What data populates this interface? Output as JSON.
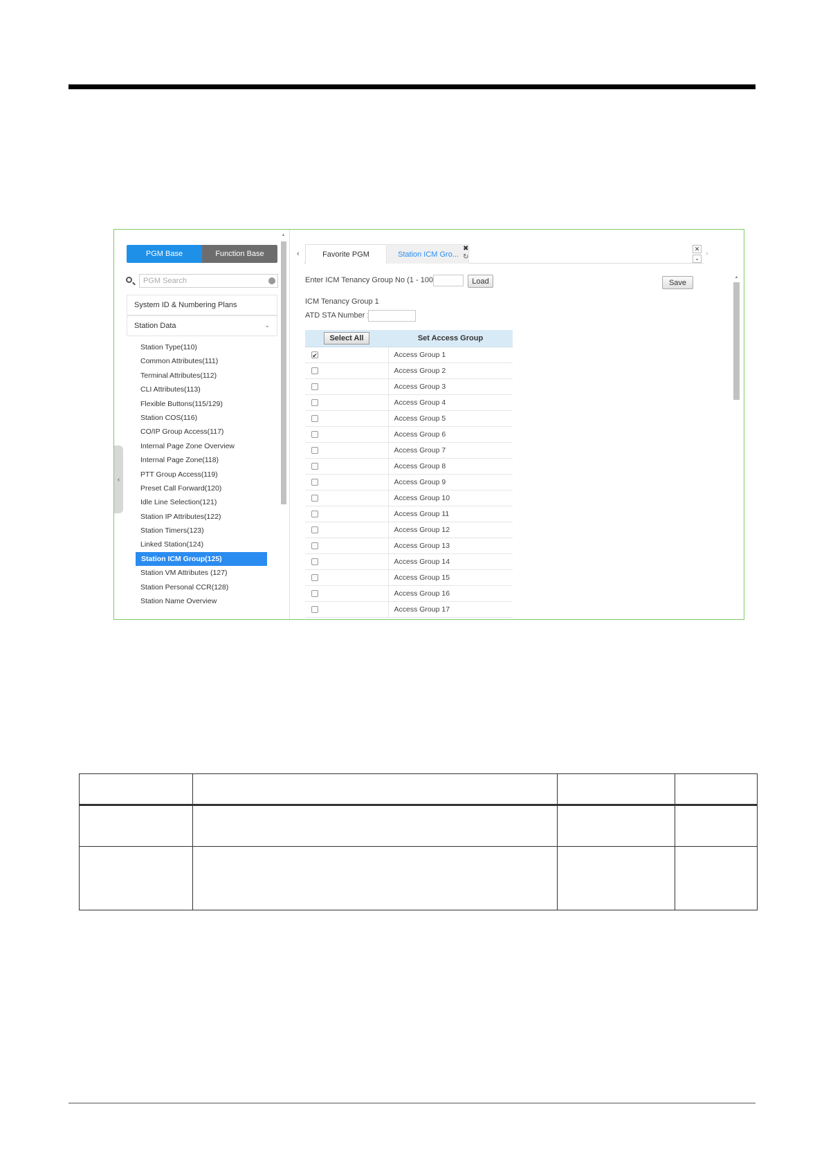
{
  "left_panel": {
    "segment": [
      "PGM Base",
      "Function Base"
    ],
    "search_placeholder": "PGM Search",
    "system_item": "System ID & Numbering Plans",
    "station_data": "Station Data",
    "menu_items": [
      "Station Type(110)",
      "Common Attributes(111)",
      "Terminal Attributes(112)",
      "CLI Attributes(113)",
      "Flexible Buttons(115/129)",
      "Station COS(116)",
      "CO/IP Group Access(117)",
      "Internal Page Zone Overview",
      "Internal Page Zone(118)",
      "PTT Group Access(119)",
      "Preset Call Forward(120)",
      "Idle Line Selection(121)",
      "Station IP Attributes(122)",
      "Station Timers(123)",
      "Linked Station(124)",
      "Station ICM Group(125)",
      "Station VM Attributes (127)",
      "Station Personal CCR(128)",
      "Station Name Overview"
    ],
    "active_index": 15
  },
  "tabs": {
    "favorite": "Favorite PGM",
    "current": "Station ICM Gro..."
  },
  "form": {
    "tenancy_label": "Enter ICM Tenancy Group No (1 - 100) :",
    "load": "Load",
    "save": "Save",
    "group_title": "ICM Tenancy Group 1",
    "atd_label": "ATD STA Number :"
  },
  "grid": {
    "select_all": "Select All",
    "header": "Set Access Group",
    "rows": [
      {
        "name": "Access Group 1",
        "checked": true
      },
      {
        "name": "Access Group 2",
        "checked": false
      },
      {
        "name": "Access Group 3",
        "checked": false
      },
      {
        "name": "Access Group 4",
        "checked": false
      },
      {
        "name": "Access Group 5",
        "checked": false
      },
      {
        "name": "Access Group 6",
        "checked": false
      },
      {
        "name": "Access Group 7",
        "checked": false
      },
      {
        "name": "Access Group 8",
        "checked": false
      },
      {
        "name": "Access Group 9",
        "checked": false
      },
      {
        "name": "Access Group 10",
        "checked": false
      },
      {
        "name": "Access Group 11",
        "checked": false
      },
      {
        "name": "Access Group 12",
        "checked": false
      },
      {
        "name": "Access Group 13",
        "checked": false
      },
      {
        "name": "Access Group 14",
        "checked": false
      },
      {
        "name": "Access Group 15",
        "checked": false
      },
      {
        "name": "Access Group 16",
        "checked": false
      },
      {
        "name": "Access Group 17",
        "checked": false
      }
    ]
  },
  "icons": {
    "search": "search-icon",
    "clear": "clear-icon",
    "close": "close-icon",
    "refresh": "refresh-icon",
    "chevron": "chevron-down-icon"
  },
  "colors": {
    "accent": "#1e90e8",
    "frame": "#7fca63",
    "header_bg": "#d9eaf7"
  }
}
